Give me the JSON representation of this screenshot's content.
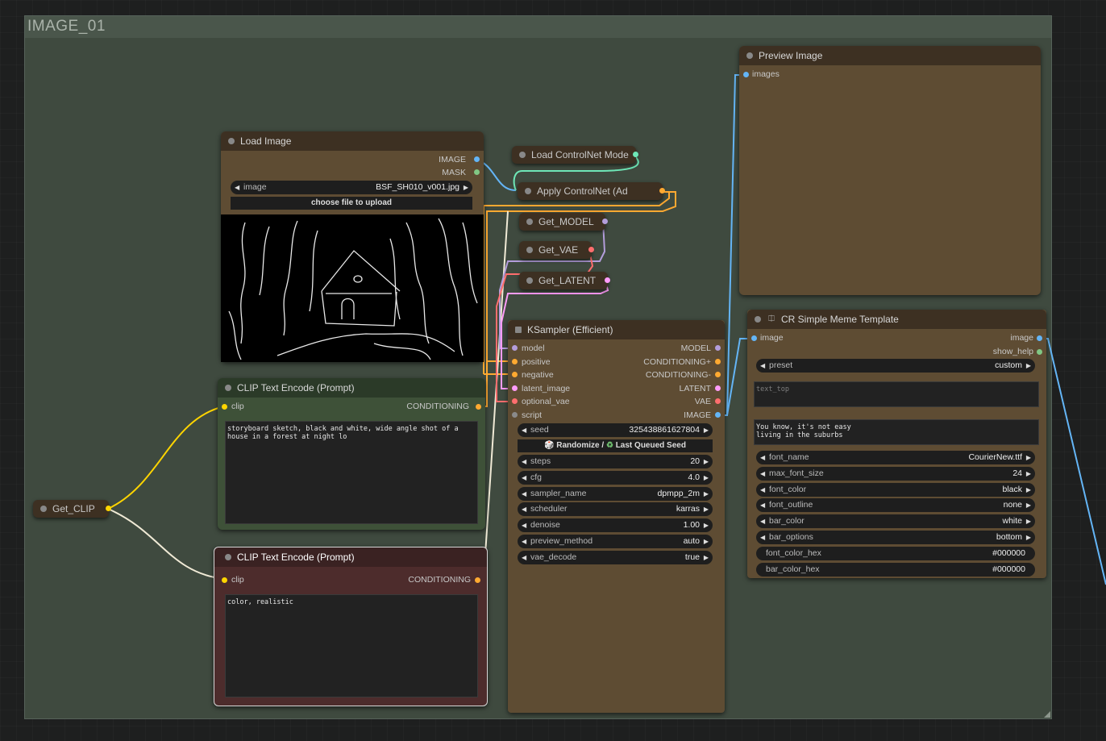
{
  "group": {
    "title": "IMAGE_01"
  },
  "load_image": {
    "title": "Load Image",
    "outputs": [
      "IMAGE",
      "MASK"
    ],
    "image_label": "image",
    "image_value": "BSF_SH010_v001.jpg",
    "upload_label": "choose file to upload"
  },
  "clip_pos": {
    "title": "CLIP Text Encode (Prompt)",
    "input": "clip",
    "output": "CONDITIONING",
    "text": "storyboard sketch, black and white, wide angle shot of a house in a forest at night lo"
  },
  "clip_neg": {
    "title": "CLIP Text Encode (Prompt)",
    "input": "clip",
    "output": "CONDITIONING",
    "text": "color, realistic"
  },
  "get_clip": {
    "title": "Get_CLIP"
  },
  "load_controlnet": {
    "title": "Load ControlNet Mode"
  },
  "apply_controlnet": {
    "title": "Apply ControlNet (Ad"
  },
  "get_model": {
    "title": "Get_MODEL"
  },
  "get_vae": {
    "title": "Get_VAE"
  },
  "get_latent": {
    "title": "Get_LATENT"
  },
  "ksampler": {
    "title": "KSampler (Efficient)",
    "inputs": [
      "model",
      "positive",
      "negative",
      "latent_image",
      "optional_vae",
      "script"
    ],
    "outputs": [
      "MODEL",
      "CONDITIONING+",
      "CONDITIONING-",
      "LATENT",
      "VAE",
      "IMAGE"
    ],
    "seed": {
      "label": "seed",
      "value": "325438861627804"
    },
    "randomize_label": "Randomize /",
    "last_seed_label": "Last Queued Seed",
    "widgets": [
      {
        "label": "steps",
        "value": "20"
      },
      {
        "label": "cfg",
        "value": "4.0"
      },
      {
        "label": "sampler_name",
        "value": "dpmpp_2m"
      },
      {
        "label": "scheduler",
        "value": "karras"
      },
      {
        "label": "denoise",
        "value": "1.00"
      },
      {
        "label": "preview_method",
        "value": "auto"
      },
      {
        "label": "vae_decode",
        "value": "true"
      }
    ]
  },
  "preview": {
    "title": "Preview Image",
    "input": "images"
  },
  "meme": {
    "title": "CR Simple Meme Template",
    "input": "image",
    "outputs": [
      "image",
      "show_help"
    ],
    "preset": {
      "label": "preset",
      "value": "custom"
    },
    "text_top_placeholder": "text_top",
    "text_bottom": "You know, it's not easy\nliving in the suburbs",
    "widgets": [
      {
        "label": "font_name",
        "value": "CourierNew.ttf"
      },
      {
        "label": "max_font_size",
        "value": "24"
      },
      {
        "label": "font_color",
        "value": "black"
      },
      {
        "label": "font_outline",
        "value": "none"
      },
      {
        "label": "bar_color",
        "value": "white"
      },
      {
        "label": "bar_options",
        "value": "bottom"
      }
    ],
    "hex_widgets": [
      {
        "label": "font_color_hex",
        "value": "#000000"
      },
      {
        "label": "bar_color_hex",
        "value": "#000000"
      }
    ]
  },
  "colors": {
    "image": "#64b5f6",
    "mask": "#81c784",
    "clip": "#ffd500",
    "conditioning": "#ffa931",
    "model": "#b39ddb",
    "vae": "#ff6e6e",
    "latent": "#ff9cf9",
    "controlnet": "#6ee7b7",
    "wire_white": "#f0ead6"
  }
}
